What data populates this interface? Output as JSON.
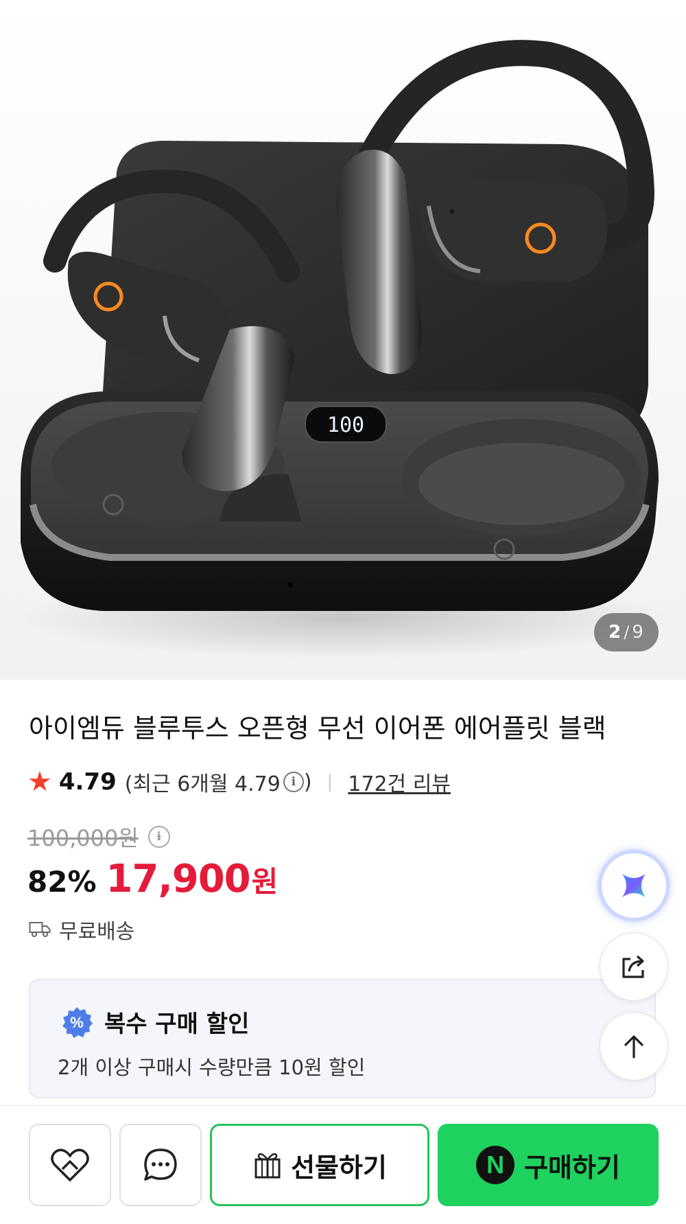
{
  "gallery": {
    "current_index": "2",
    "separator": "/",
    "total": "9",
    "display_readout": "100"
  },
  "product": {
    "title": "아이엠듀 블루투스 오픈형 무선 이어폰 에어플릿 블랙",
    "rating": "4.79",
    "recent_rating_label": "(최근 6개월 4.79",
    "recent_rating_close": ")",
    "review_count_label": "172건 리뷰",
    "original_price": "100,000원",
    "discount_rate": "82%",
    "sale_price": "17,900",
    "currency": "원",
    "shipping": "무료배송"
  },
  "bulk_discount": {
    "badge_symbol": "%",
    "title": "복수 구매 할인",
    "description": "2개 이상 구매시 수량만큼 10원 할인"
  },
  "floating_actions": {
    "ai_icon": "ai-assistant-icon",
    "share_icon": "share-icon",
    "top_icon": "arrow-up-icon"
  },
  "bottom_bar": {
    "like_icon": "heart-icon",
    "talk_icon": "chat-icon",
    "gift_label": "선물하기",
    "buy_label": "구매하기",
    "npay_symbol": "N"
  },
  "colors": {
    "sale_red": "#e41b3a",
    "rating_star": "#f0412c",
    "buy_green": "#1fd15e",
    "gift_border": "#25c25a",
    "badge_blue": "#4f7de8"
  }
}
